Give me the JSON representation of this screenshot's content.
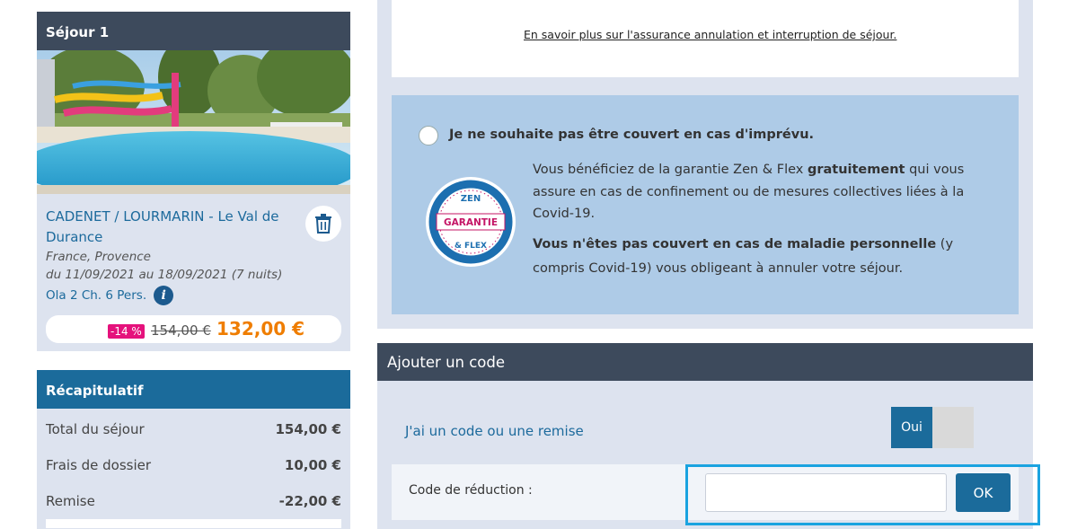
{
  "sejour": {
    "header": "Séjour 1",
    "camp_name": "CADENET / LOURMARIN - Le Val de Durance",
    "location": "France, Provence",
    "dates": "du 11/09/2021 au 18/09/2021 (7 nuits)",
    "room": "Ola 2 Ch. 6 Pers.",
    "discount": "-14 %",
    "old_price": "154,00 €",
    "new_price": "132,00 €"
  },
  "recap": {
    "header": "Récapitulatif",
    "rows": [
      {
        "label": "Total du séjour",
        "amount": "154,00 €"
      },
      {
        "label": "Frais de dossier",
        "amount": "10,00 €"
      },
      {
        "label": "Remise",
        "amount": "-22,00 €"
      }
    ]
  },
  "insurance": {
    "link": "En savoir plus sur l'assurance annulation et interruption de séjour."
  },
  "no_cover": {
    "label": "Je ne souhaite pas être couvert en cas d'imprévu.",
    "p1_a": "Vous bénéficiez de la garantie Zen & Flex ",
    "p1_b": "gratuitement",
    "p1_c": " qui vous assure en cas de confinement ou de mesures collectives liées à la Covid-19.",
    "p2_a": "Vous n'êtes pas couvert en cas de maladie personnelle",
    "p2_b": " (y compris Covid-19) vous obligeant à annuler votre séjour.",
    "badge_top": "ZEN",
    "badge_mid": "GARANTIE",
    "badge_bottom": "& FLEX"
  },
  "code": {
    "header": "Ajouter un code",
    "question": "J'ai un code ou une remise",
    "toggle_label": "Oui",
    "field_label": "Code de réduction :",
    "input_value": "",
    "ok_label": "OK"
  },
  "colors": {
    "primary_blue": "#1b6b9b",
    "dark_header": "#3d4a5c",
    "price_orange": "#ef7d00",
    "discount_pink": "#e5127c",
    "highlight": "#1aa3e0"
  }
}
